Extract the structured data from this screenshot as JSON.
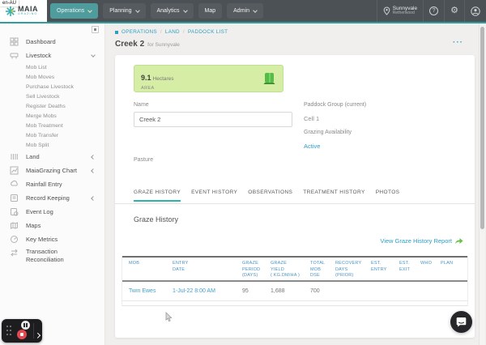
{
  "locale_badge": "en-AU",
  "brand": {
    "name": "MAIA",
    "sub": "GRAZING"
  },
  "nav": {
    "items": [
      {
        "label": "Operations",
        "active": true
      },
      {
        "label": "Planning",
        "active": false
      },
      {
        "label": "Analytics",
        "active": false
      },
      {
        "label": "Map",
        "active": false
      },
      {
        "label": "Admin",
        "active": false
      }
    ]
  },
  "user_area": {
    "location": "Sunnyvale",
    "sublocation": "Retherwood",
    "help": "?"
  },
  "sidebar": {
    "items": [
      {
        "label": "Dashboard"
      },
      {
        "label": "Livestock"
      },
      {
        "label": "Land"
      },
      {
        "label": "MaiaGrazing Chart"
      },
      {
        "label": "Rainfall Entry"
      },
      {
        "label": "Record Keeping"
      },
      {
        "label": "Event Log"
      },
      {
        "label": "Maps"
      },
      {
        "label": "Key Metrics"
      },
      {
        "label": "Transaction Reconciliation"
      }
    ],
    "livestock_submenu": [
      "Mob List",
      "Mob Moves",
      "Purchase Livestock",
      "Sell Livestock",
      "Register Deaths",
      "Merge Mobs",
      "Mob Treatment",
      "Mob Transfer",
      "Mob Split"
    ]
  },
  "breadcrumb": {
    "items": [
      "OPERATIONS",
      "LAND",
      "PADDOCK LIST"
    ],
    "separator": "/"
  },
  "page": {
    "title": "Creek 2",
    "subtitle": "for Sunnyvale",
    "more": "···"
  },
  "stat": {
    "value": "9.1",
    "unit": "Hectares",
    "label": "AREA"
  },
  "form": {
    "name_label": "Name",
    "name_value": "Creek 2",
    "paddock_group_label": "Paddock Group (current)",
    "paddock_group_value": "Cell 1",
    "grazing_label": "Grazing Availability",
    "grazing_value": "Active",
    "pasture_label": "Pasture"
  },
  "tabs": [
    "GRAZE HISTORY",
    "EVENT HISTORY",
    "OBSERVATIONS",
    "TREATMENT HISTORY",
    "PHOTOS"
  ],
  "graze_history": {
    "heading": "Graze History",
    "report_link": "View Graze History Report",
    "table": {
      "headers": [
        "MOB",
        "ENTRY\nDATE",
        "GRAZE\nPERIOD\n(DAYS)",
        "GRAZE\nYIELD\n( KG.DM/HA )",
        "TOTAL\nMOB\nDSE",
        "RECOVERY\nDAYS\n(PRIOR)",
        "EST.\nENTRY",
        "EST.\nEXIT",
        "WHO",
        "PLAN"
      ],
      "rows": [
        [
          "Twin Ewes",
          "1-Jul-22 8:00 AM",
          "95",
          "1,688",
          "700",
          "",
          "",
          "",
          "",
          ""
        ]
      ]
    }
  },
  "colors": {
    "accent_teal": "#4e9c9e",
    "tab_underline": "#2bb3ac",
    "link_blue": "#2f9fc4",
    "table_header_blue": "#4c93c1",
    "stat_green_bg": "#d6eda5",
    "stat_icon_green": "#55bd45",
    "record_red": "#e5484d",
    "topbar_dark": "#4c5156"
  }
}
